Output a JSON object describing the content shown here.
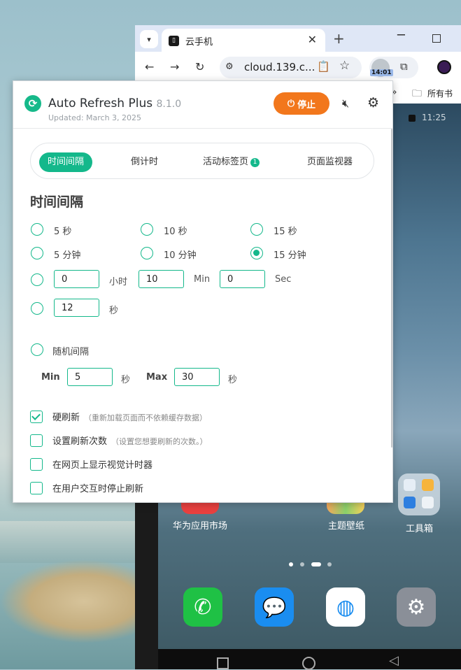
{
  "browser": {
    "tab_title": "云手机",
    "new_tab": "+",
    "url": "cloud.139.c...",
    "ext_time": "14:01",
    "bookmark_label": "所有书",
    "bookmark_more": "»"
  },
  "phone": {
    "status_time": "11:25",
    "apps": [
      "华为应用市场",
      "主题壁纸",
      "工具箱"
    ]
  },
  "popup": {
    "app_name": "Auto Refresh Plus",
    "version": "8.1.0",
    "updated": "Updated: March 3, 2025",
    "stop_label": "停止",
    "tabs": [
      {
        "label": "时间间隔",
        "active": true
      },
      {
        "label": "倒计时"
      },
      {
        "label": "活动标签页",
        "badge": "1"
      },
      {
        "label": "页面监视器"
      }
    ],
    "section_title": "时间间隔",
    "interval_options": [
      {
        "label": "5 秒",
        "checked": false
      },
      {
        "label": "10 秒",
        "checked": false
      },
      {
        "label": "15 秒",
        "checked": false
      },
      {
        "label": "5 分钟",
        "checked": false
      },
      {
        "label": "10 分钟",
        "checked": false
      },
      {
        "label": "15 分钟",
        "checked": true
      }
    ],
    "custom_time": {
      "hours": "0",
      "hours_unit": "小时",
      "minutes": "10",
      "minutes_unit": "Min",
      "seconds": "0",
      "seconds_unit": "Sec"
    },
    "custom_seconds": {
      "value": "12",
      "unit": "秒"
    },
    "random": {
      "label": "随机间隔",
      "min_label": "Min",
      "min_value": "5",
      "min_unit": "秒",
      "max_label": "Max",
      "max_value": "30",
      "max_unit": "秒"
    },
    "checkboxes": [
      {
        "label": "硬刷新",
        "hint": "（重新加载页面而不依赖缓存数据）",
        "checked": true
      },
      {
        "label": "设置刷新次数",
        "hint": "（设置您想要刷新的次数。）",
        "checked": false
      },
      {
        "label": "在网页上显示视觉计时器",
        "hint": "",
        "checked": false
      },
      {
        "label": "在用户交互时停止刷新",
        "hint": "",
        "checked": false
      }
    ]
  }
}
